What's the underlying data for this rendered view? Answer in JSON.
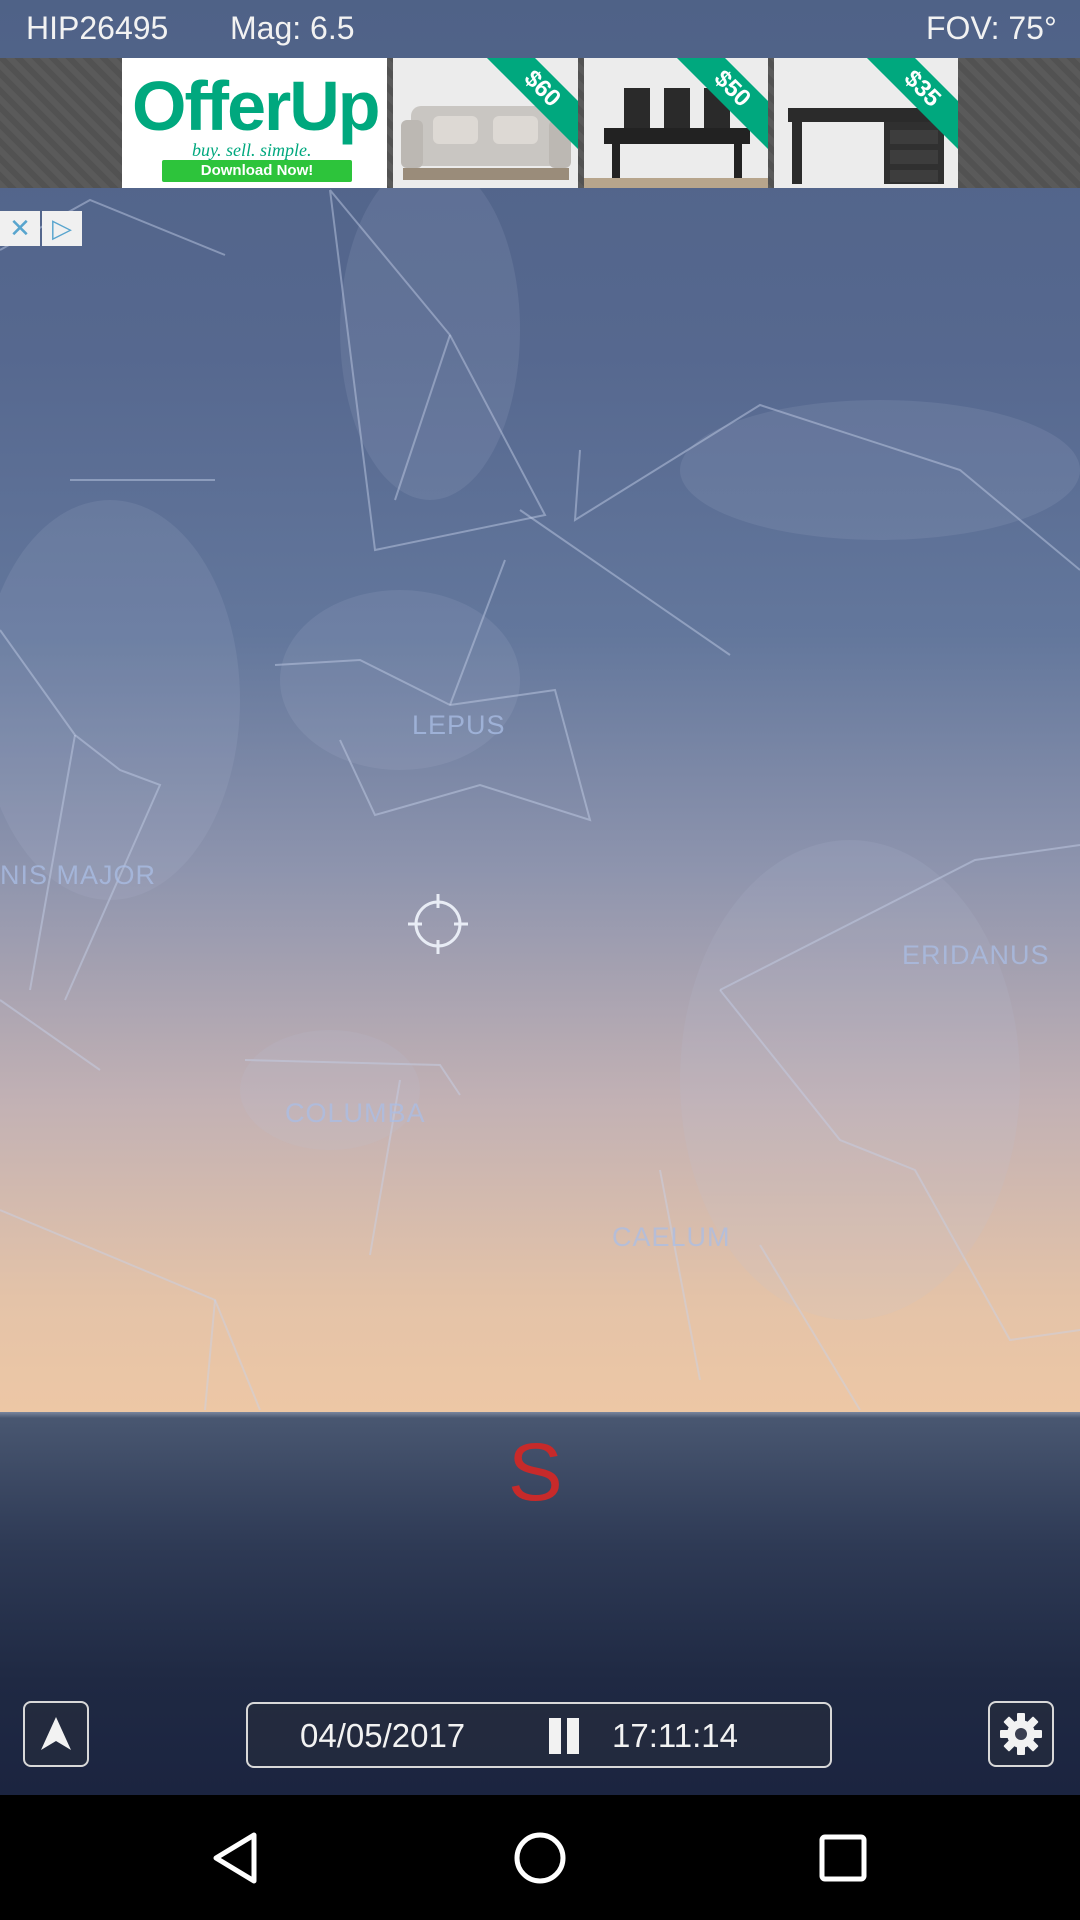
{
  "status": {
    "star_id": "HIP26495",
    "magnitude": "Mag: 6.5",
    "fov": "FOV: 75°"
  },
  "ad": {
    "brand": "OfferUp",
    "tagline": "buy. sell. simple.",
    "cta": "Download Now!",
    "items": [
      {
        "price": "$60",
        "name": "sofa"
      },
      {
        "price": "$50",
        "name": "dining-set"
      },
      {
        "price": "$35",
        "name": "desk"
      }
    ],
    "close_icon": "close-icon",
    "info_icon": "adchoices-icon"
  },
  "sky": {
    "constellations": [
      {
        "label": "LEPUS"
      },
      {
        "label": "NIS MAJOR"
      },
      {
        "label": "ERIDANUS"
      },
      {
        "label": "COLUMBA"
      },
      {
        "label": "CAELUM"
      }
    ],
    "crosshair_icon": "crosshair-icon"
  },
  "compass": {
    "direction": "S",
    "color": "#c72a2a"
  },
  "controls": {
    "date": "04/05/2017",
    "time": "17:11:14",
    "pause_icon": "pause-icon",
    "navigate_icon": "navigation-arrow-icon",
    "settings_icon": "gear-icon"
  },
  "navbar": {
    "back_icon": "back-icon",
    "home_icon": "home-icon",
    "recents_icon": "recents-icon"
  }
}
